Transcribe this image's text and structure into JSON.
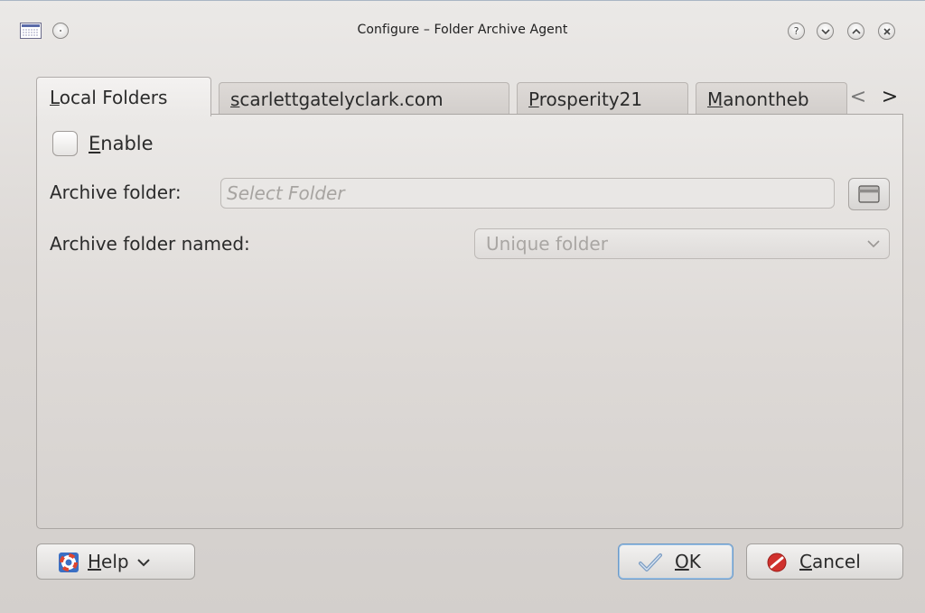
{
  "window": {
    "title": "Configure – Folder Archive Agent",
    "buttons": {
      "help": "?",
      "minimize": "minimize",
      "maximize": "maximize",
      "close": "close"
    }
  },
  "tabs": [
    {
      "label": "Local Folders",
      "mnemonic": "L",
      "rest": "ocal Folders",
      "active": true
    },
    {
      "label": "scarlettgatelyclark.com",
      "mnemonic": "s",
      "rest": "carlettgatelyclark.com",
      "active": false
    },
    {
      "label": "Prosperity21",
      "mnemonic": "P",
      "rest": "rosperity21",
      "active": false
    },
    {
      "label": "Manontheb",
      "mnemonic": "M",
      "rest": "anontheb",
      "active": false
    }
  ],
  "tab_scroll": {
    "left": "<",
    "right": ">"
  },
  "form": {
    "enable": {
      "mnemonic": "E",
      "rest": "nable",
      "checked": false
    },
    "archive_folder_label": "Archive folder:",
    "archive_folder_placeholder": "Select Folder",
    "archive_folder_value": "",
    "named_label": "Archive folder named:",
    "named_value": "Unique folder"
  },
  "buttons": {
    "help": {
      "mnemonic": "H",
      "rest": "elp",
      "chevron": "⌄"
    },
    "ok": {
      "mnemonic": "O",
      "rest": "K"
    },
    "cancel": {
      "mnemonic": "C",
      "rest": "ancel"
    }
  },
  "colors": {
    "accent": "#6c9ac8",
    "cancel_red": "#d0312d"
  }
}
